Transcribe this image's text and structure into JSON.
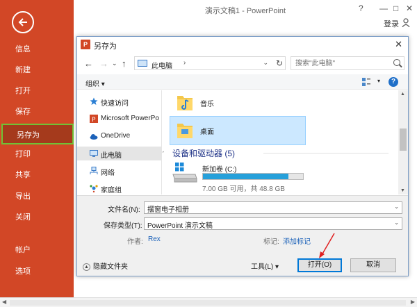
{
  "app": {
    "title": "演示文稿1 - PowerPoint",
    "help": "?",
    "minimize": "—",
    "restore": "□",
    "close": "✕",
    "login": "登录",
    "accent": "#d24726"
  },
  "backstage": {
    "items": [
      {
        "label": "信息"
      },
      {
        "label": "新建"
      },
      {
        "label": "打开"
      },
      {
        "label": "保存"
      },
      {
        "label": "另存为",
        "active": true
      },
      {
        "label": "打印"
      },
      {
        "label": "共享"
      },
      {
        "label": "导出"
      },
      {
        "label": "关闭"
      },
      {
        "label": "帐户"
      },
      {
        "label": "选项"
      }
    ]
  },
  "dialog": {
    "icon_letter": "P",
    "title": "另存为",
    "close": "✕",
    "address": {
      "location": "此电脑",
      "sep": "›",
      "dropdown": "⌄",
      "refresh": "↻"
    },
    "search_placeholder": "搜索\"此电脑\"",
    "toolbar": {
      "organize": "组织 ▾",
      "help": "?"
    },
    "nav_pane": [
      {
        "label": "快速访问",
        "icon": "quick-access-icon"
      },
      {
        "label": "Microsoft PowerPo",
        "icon": "powerpoint-icon"
      },
      {
        "label": "OneDrive",
        "icon": "onedrive-icon"
      },
      {
        "label": "此电脑",
        "icon": "pc-icon",
        "selected": true
      },
      {
        "label": "网络",
        "icon": "network-icon"
      },
      {
        "label": "家庭组",
        "icon": "homegroup-icon"
      }
    ],
    "content": {
      "folders": [
        {
          "label": "音乐",
          "icon": "music-folder-icon"
        },
        {
          "label": "桌面",
          "icon": "desktop-folder-icon",
          "selected": true
        }
      ],
      "group_header": "设备和驱动器 (5)",
      "drive": {
        "name": "新加卷 (C:)",
        "info": "7.00 GB 可用，共 48.8 GB",
        "used_fraction": 0.857
      }
    },
    "form": {
      "filename_label": "文件名(N):",
      "filename_value": "摆窗电子相册",
      "type_label": "保存类型(T):",
      "type_value": "PowerPoint 演示文稿",
      "author_label": "作者:",
      "author_value": "Rex",
      "tags_label": "标记:",
      "tags_value": "添加标记",
      "hide_folders": "隐藏文件夹",
      "tools": "工具(L)   ▾",
      "open": "打开(O)",
      "cancel": "取消"
    }
  }
}
